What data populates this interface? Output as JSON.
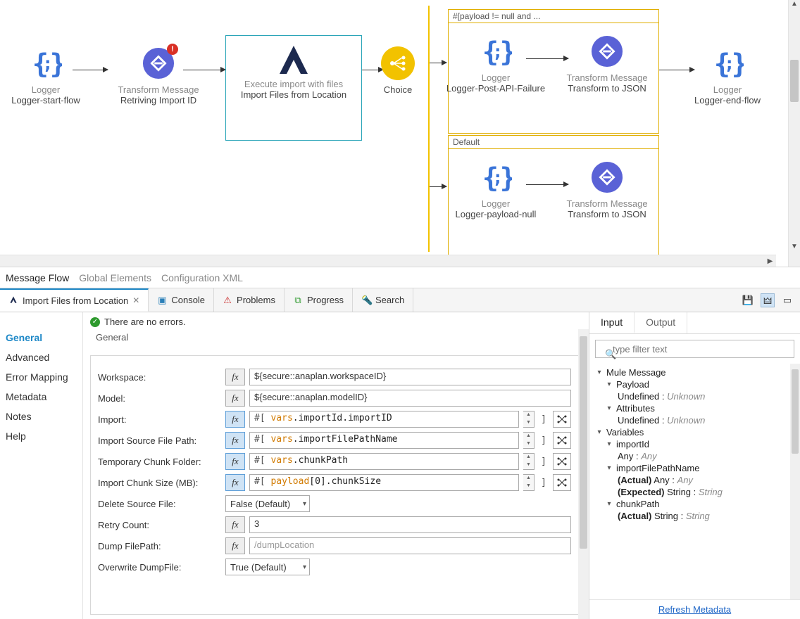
{
  "canvas": {
    "nodes": {
      "logger_start": {
        "type": "Logger",
        "name": "Logger-start-flow"
      },
      "transform_retrieve": {
        "type": "Transform Message",
        "name": "Retriving Import ID",
        "hasError": true
      },
      "execute_import": {
        "type": "Execute import with files",
        "name": "Import Files from Location"
      },
      "choice": {
        "type": "Choice",
        "name": ""
      },
      "branch1_label": "#[payload != null and ...",
      "branch1": {
        "logger": {
          "type": "Logger",
          "name": "Logger-Post-API-Failure"
        },
        "transform": {
          "type": "Transform Message",
          "name": "Transform to JSON"
        }
      },
      "branch2_label": "Default",
      "branch2": {
        "logger": {
          "type": "Logger",
          "name": "Logger-payload-null"
        },
        "transform": {
          "type": "Transform Message",
          "name": "Transform to JSON"
        }
      },
      "logger_end": {
        "type": "Logger",
        "name": "Logger-end-flow"
      }
    }
  },
  "flowTabs": {
    "messageFlow": "Message Flow",
    "globalElements": "Global Elements",
    "configXml": "Configuration XML"
  },
  "editorTabs": {
    "active": "Import Files from Location",
    "console": "Console",
    "problems": "Problems",
    "progress": "Progress",
    "search": "Search"
  },
  "sidebar": {
    "general": "General",
    "advanced": "Advanced",
    "errorMapping": "Error Mapping",
    "metadata": "Metadata",
    "notes": "Notes",
    "help": "Help"
  },
  "status": "There are no errors.",
  "form": {
    "legend": "General",
    "workspace": {
      "label": "Workspace:",
      "value": "${secure::anaplan.workspaceID}",
      "fx": false
    },
    "model": {
      "label": "Model:",
      "value": "${secure::anaplan.modelID}",
      "fx": false
    },
    "import": {
      "label": "Import:",
      "prefix": "#[ ",
      "var": "vars",
      "rest": ".importId.importID",
      "fx": true,
      "hasSpin": true,
      "hasMap": true
    },
    "importSourcePath": {
      "label": "Import Source File Path:",
      "prefix": "#[ ",
      "var": "vars",
      "rest": ".importFilePathName",
      "fx": true,
      "hasSpin": true,
      "hasMap": true
    },
    "tempChunk": {
      "label": "Temporary Chunk Folder:",
      "prefix": "#[ ",
      "var": "vars",
      "rest": ".chunkPath",
      "fx": true,
      "hasSpin": true,
      "hasMap": true
    },
    "chunkSize": {
      "label": "Import Chunk Size (MB):",
      "prefix": "#[ ",
      "var": "payload",
      "rest": "[0].chunkSize",
      "fx": true,
      "hasSpin": true,
      "hasMap": true
    },
    "deleteSource": {
      "label": "Delete Source File:",
      "value": "False (Default)"
    },
    "retryCount": {
      "label": "Retry Count:",
      "value": "3",
      "fx": false
    },
    "dumpPath": {
      "label": "Dump FilePath:",
      "placeholder": "/dumpLocation",
      "fx": false
    },
    "overwriteDump": {
      "label": "Overwrite DumpFile:",
      "value": "True (Default)"
    }
  },
  "io": {
    "tabInput": "Input",
    "tabOutput": "Output",
    "filterPlaceholder": "type filter text",
    "tree": {
      "muleMessage": "Mule Message",
      "payload": "Payload",
      "payloadVal": "Undefined : ",
      "payloadType": "Unknown",
      "attributes": "Attributes",
      "attributesVal": "Undefined : ",
      "attributesType": "Unknown",
      "variables": "Variables",
      "importId": "importId",
      "importIdVal": "Any : ",
      "importIdType": "Any",
      "importFilePathName": "importFilePathName",
      "ifpActual": "(Actual)",
      "ifpActualVal": " Any : ",
      "ifpActualType": "Any",
      "ifpExpected": "(Expected)",
      "ifpExpectedVal": " String : ",
      "ifpExpectedType": "String",
      "chunkPath": "chunkPath",
      "cpActual": "(Actual)",
      "cpActualVal": " String : ",
      "cpActualType": "String"
    },
    "refresh": "Refresh Metadata"
  }
}
